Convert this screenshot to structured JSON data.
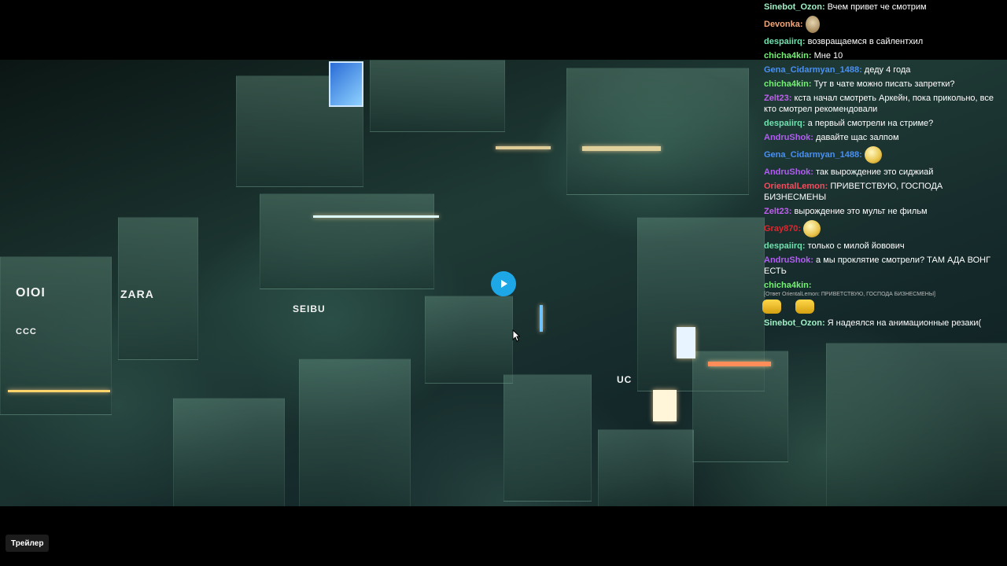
{
  "video": {
    "signs": {
      "oioi": "OIOI",
      "zara": "ZARA",
      "seibu": "SEIBU",
      "ccc": "CCC",
      "uc": "UC"
    },
    "play_icon": "play-icon"
  },
  "chat": {
    "messages": [
      {
        "user": "Sinebot_Ozon:",
        "color": "#9ff0c4",
        "text": "Вчем привет че смотрим"
      },
      {
        "user": "Devonka:",
        "color": "#f2a77a",
        "text": "",
        "emote": "shrug-emote"
      },
      {
        "user": "despaiirq:",
        "color": "#6fe3b0",
        "text": "возвращаемся в сайлентхил"
      },
      {
        "user": "chicha4kin:",
        "color": "#78ef78",
        "text": "Мне 10"
      },
      {
        "user": "Gena_Cidarmyan_1488:",
        "color": "#4a90f0",
        "text": "деду 4 года"
      },
      {
        "user": "chicha4kin:",
        "color": "#78ef78",
        "text": "Тут в чате можно писать запретки?"
      },
      {
        "user": "Zelt23:",
        "color": "#c15ef0",
        "text": "кста начал смотреть Аркейн, пока прикольно, все кто смотрел рекомендовали"
      },
      {
        "user": "despaiirq:",
        "color": "#6fe3b0",
        "text": "а первый смотрели на стриме?"
      },
      {
        "user": "AndruShok:",
        "color": "#b05ef0",
        "text": "давайте щас залпом"
      },
      {
        "user": "Gena_Cidarmyan_1488:",
        "color": "#4a90f0",
        "text": "",
        "emote": "smile-emote"
      },
      {
        "user": "AndruShok:",
        "color": "#b05ef0",
        "text": "так вырождение это сиджиай"
      },
      {
        "user": "OrientalLemon:",
        "color": "#f04e5e",
        "text": "ПРИВЕТСТВУЮ, ГОСПОДА БИЗНЕСМЕНЫ"
      },
      {
        "user": "Zelt23:",
        "color": "#c15ef0",
        "text": "вырождение это мульт не фильм"
      },
      {
        "user": "Gray870:",
        "color": "#e0262e",
        "text": "",
        "emote": "grin-emote"
      },
      {
        "user": "despaiirq:",
        "color": "#6fe3b0",
        "text": "только с милой йовович"
      },
      {
        "user": "AndruShok:",
        "color": "#b05ef0",
        "text": "а мы проклятие смотрели? ТАМ АДА ВОНГ ЕСТЬ"
      },
      {
        "user": "chicha4kin:",
        "color": "#78ef78",
        "text": ""
      }
    ],
    "reply_note": "[Ответ OrientalLemon: ПРИВЕТСТВУЮ, ГОСПОДА БИЗНЕСМЕНЫ]",
    "last": {
      "user": "Sinebot_Ozon:",
      "color": "#9ff0c4",
      "text": "Я надеялся на анимационные резаки("
    }
  },
  "trailer_button": {
    "label": "Трейлер"
  }
}
